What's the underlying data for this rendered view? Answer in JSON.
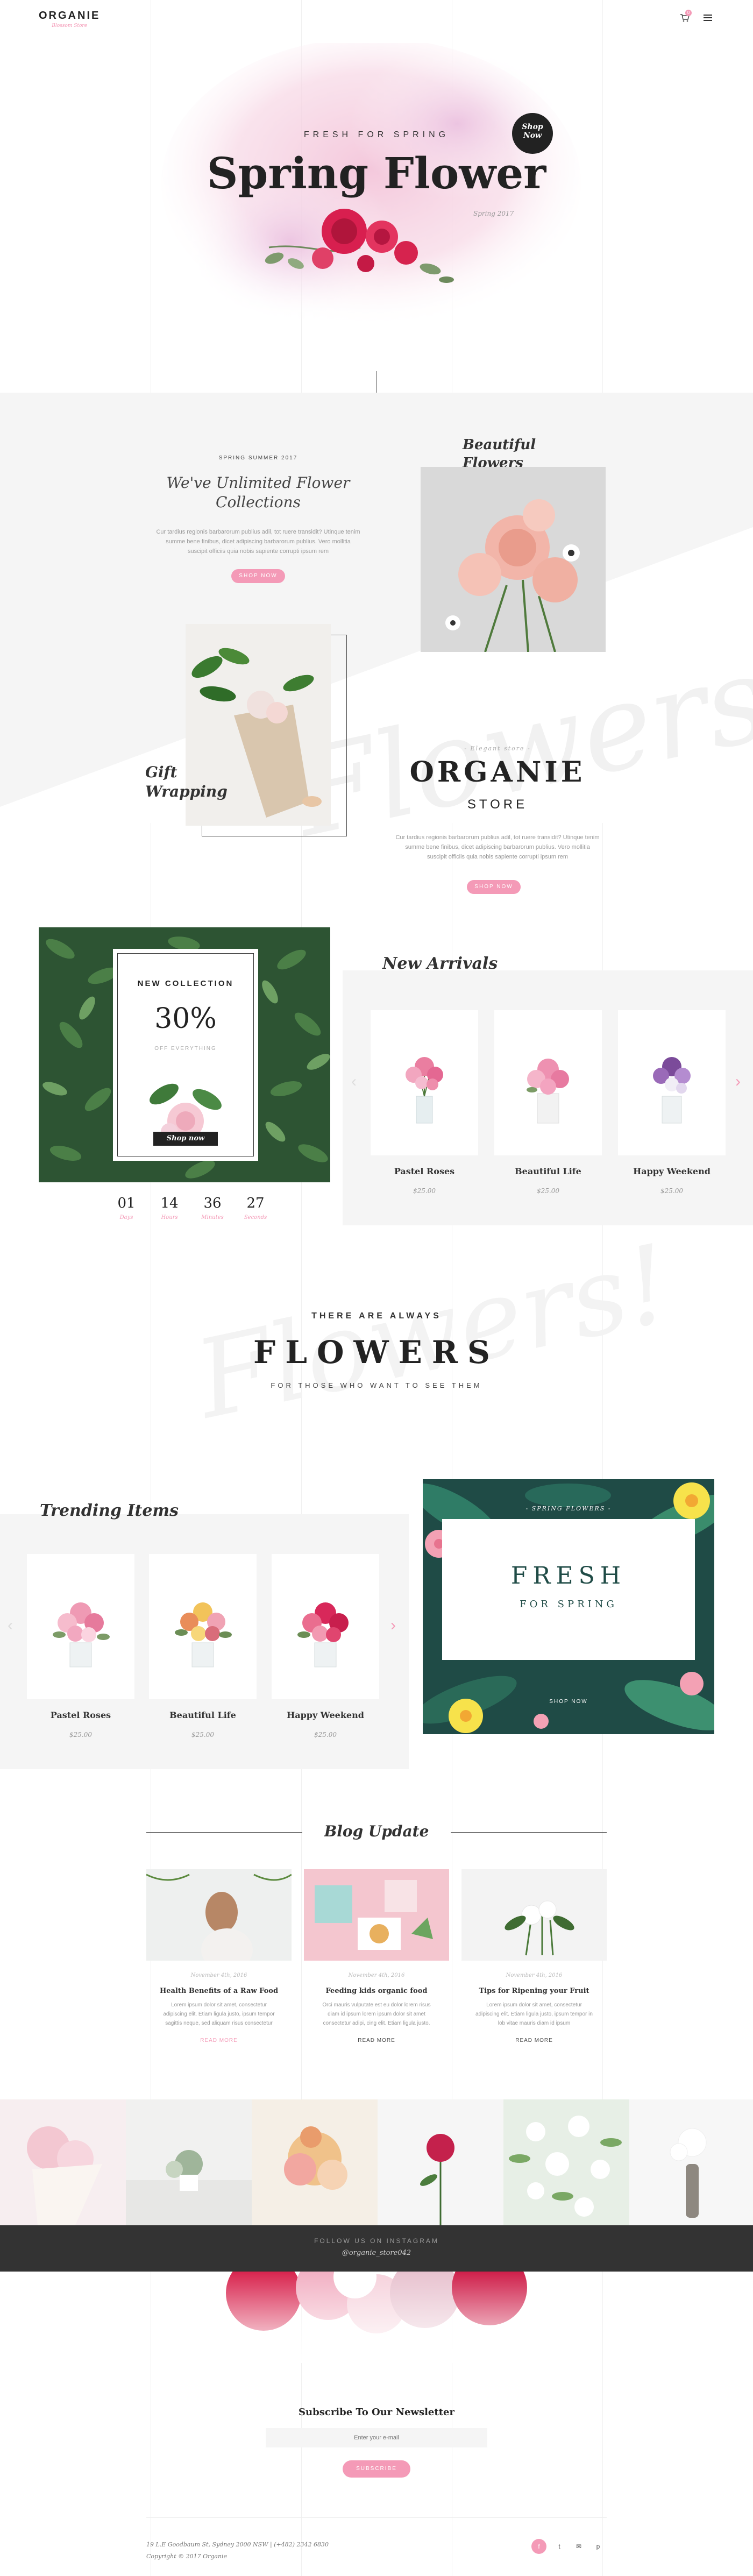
{
  "header": {
    "logo_text": "ORGANIE",
    "logo_tagline": "Blossom Store",
    "cart_count": "0"
  },
  "hero": {
    "kicker": "FRESH FOR SPRING",
    "title": "Spring Flower",
    "subtitle": "Spring 2017",
    "badge_line1": "Shop",
    "badge_line2": "Now"
  },
  "collections": {
    "kicker": "SPRING SUMMER 2017",
    "heading": "We've Unlimited Flower Collections",
    "body": "Cur tardius regionis barbarorum publius adil, tot ruere transidit? Utinque tenim summe bene finibus, dicet adipiscing barbarorum publius. Vero mollitia suscipit officiis quia nobis sapiente corrupti ipsum rem",
    "button": "SHOP NOW",
    "beautiful_label": "Beautiful Flowers",
    "gift_label": "Gift Wrapping",
    "watermark": "Flowers!"
  },
  "store": {
    "kicker": "- Elegant store -",
    "title": "ORGANIE",
    "subtitle": "STORE",
    "body": "Cur tardius regionis barbarorum publius adil, tot ruere transidit? Utinque tenim summe bene finibus, dicet adipiscing barbarorum publius. Vero mollitia suscipit officiis quia nobis sapiente corrupti ipsum rem",
    "button": "SHOP NOW"
  },
  "promo": {
    "label": "NEW COLLECTION",
    "discount": "30%",
    "sub": "OFF EVERYTHING",
    "button": "Shop now"
  },
  "countdown": [
    {
      "num": "01",
      "label": "Days"
    },
    {
      "num": "14",
      "label": "Hours"
    },
    {
      "num": "36",
      "label": "Minutes"
    },
    {
      "num": "27",
      "label": "Seconds"
    }
  ],
  "new_arrivals": {
    "heading": "New Arrivals",
    "items": [
      {
        "name": "Pastel Roses",
        "price": "$25.00"
      },
      {
        "name": "Beautiful Life",
        "price": "$25.00"
      },
      {
        "name": "Happy Weekend",
        "price": "$25.00"
      }
    ]
  },
  "flowers_banner": {
    "kicker": "THERE ARE ALWAYS",
    "title": "FLOWERS",
    "sub": "FOR THOSE WHO WANT TO SEE THEM",
    "watermark": "Flowers!"
  },
  "trending": {
    "heading": "Trending Items",
    "items": [
      {
        "name": "Pastel Roses",
        "price": "$25.00"
      },
      {
        "name": "Beautiful Life",
        "price": "$25.00"
      },
      {
        "name": "Happy Weekend",
        "price": "$25.00"
      }
    ]
  },
  "fresh_banner": {
    "kicker": "- SPRING FLOWERS -",
    "title": "FRESH",
    "sub": "FOR SPRING",
    "button": "SHOP NOW"
  },
  "blog": {
    "heading": "Blog Update",
    "posts": [
      {
        "date": "November 4th, 2016",
        "title": "Health Benefits of a Raw Food",
        "excerpt": "Lorem ipsum dolor sit amet, consectetur adipiscing elit. Etiam ligula justo, ipsum tempor sagittis neque, sed aliquam risus consectetur",
        "more": "READ MORE"
      },
      {
        "date": "November 4th, 2016",
        "title": "Feeding kids organic food",
        "excerpt": "Orci mauris vulputate est eu dolor lorem risus diam id ipsum lorem ipsum dolor sit amet consectetur adipi, cing elit. Etiam ligula justo.",
        "more": "READ MORE"
      },
      {
        "date": "November 4th, 2016",
        "title": "Tips for Ripening your Fruit",
        "excerpt": "Lorem ipsum dolor sit amet, consectetur adipiscing elit. Etiam ligula justo, ipsum tempor in lob vitae mauris diam id ipsum",
        "more": "READ MORE"
      }
    ]
  },
  "instagram": {
    "label": "FOLLOW US ON INSTAGRAM",
    "handle": "@organie_store042"
  },
  "newsletter": {
    "heading": "Subscribe To Our Newsletter",
    "placeholder": "Enter your e-mail",
    "button": "SUBSCRIBE"
  },
  "footer": {
    "address": "19 L.E Goodbaum St, Sydney 2000 NSW   |   (+482) 2342 6830",
    "copyright": "Copyright © 2017 Organie"
  },
  "colors": {
    "accent": "#f49ab7",
    "dark": "#333333",
    "light_bg": "#f5f5f5",
    "promo_green": "#2f5a34",
    "instagram_bar": "#333333"
  }
}
